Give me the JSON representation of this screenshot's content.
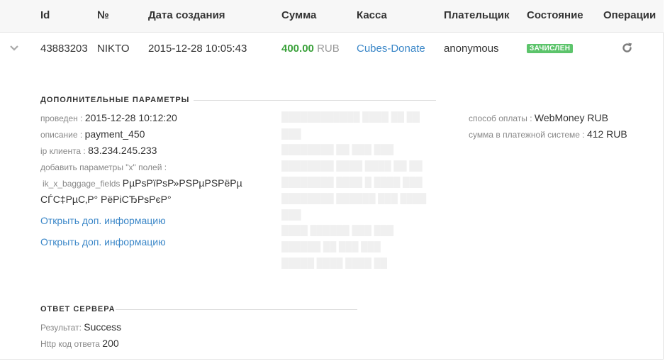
{
  "table": {
    "headers": {
      "id": "Id",
      "number": "№",
      "created": "Дата создания",
      "amount": "Сумма",
      "cashbox": "Касса",
      "payer": "Плательщик",
      "state": "Состояние",
      "operations": "Операции"
    },
    "row": {
      "id": "43883203",
      "number": "NIKTO",
      "created": "2015-12-28 10:05:43",
      "amount_value": "400.00",
      "amount_currency": "RUB",
      "cashbox": "Cubes-Donate",
      "payer": "anonymous",
      "state_badge": "ЗАЧИСЛЕН"
    }
  },
  "extra": {
    "title": "ДОПОЛНИТЕЛЬНЫЕ ПАРАМЕТРЫ",
    "paid_label": "проведен :",
    "paid_value": "2015-12-28 10:12:20",
    "desc_label": "описание :",
    "desc_value": "payment_450",
    "ip_label": "ip клиента :",
    "ip_value": "83.234.245.233",
    "xfields_label": "добавить параметры \"x\" полей :",
    "baggage_key": "ik_x_baggage_fields",
    "baggage_value_line1": "РµРѕРїРѕР»РЅРµРЅРёРµ",
    "baggage_value_line2": "СЃС‡РµС‚Р° РёРіСЂРѕРєР°",
    "more_link_1": "Открыть доп. информацию",
    "more_link_2": "Открыть доп. информацию",
    "pay_method_label": "способ оплаты :",
    "pay_method_value": "WebMoney RUB",
    "system_sum_label": "сумма в платежной системе :",
    "system_sum_value": "412 RUB"
  },
  "server": {
    "title": "ОТВЕТ СЕРВЕРА",
    "result_label": "Результат:",
    "result_value": "Success",
    "http_label": "Http код ответа",
    "http_value": "200"
  },
  "colors": {
    "accent_link": "#3b87c8",
    "amount_green": "#3aa13a",
    "badge_green": "#5cc46b"
  },
  "icons": {
    "row_toggle": "chevron-down-icon",
    "refresh": "refresh-icon"
  }
}
